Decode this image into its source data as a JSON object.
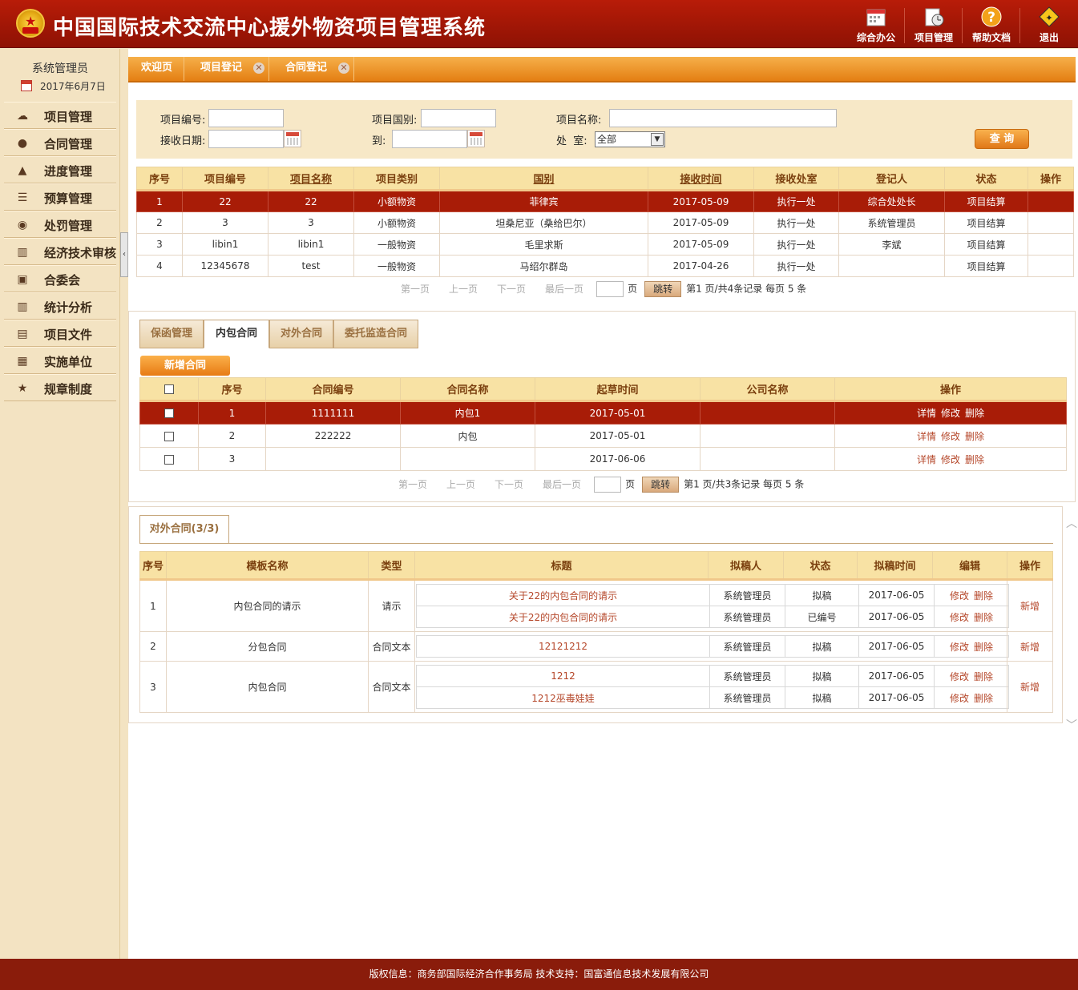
{
  "app": {
    "title": "中国国际技术交流中心援外物资项目管理系统"
  },
  "topnav": [
    {
      "label": "综合办公",
      "icon": "calendar-icon"
    },
    {
      "label": "项目管理",
      "icon": "clipboard-clock-icon"
    },
    {
      "label": "帮助文档",
      "icon": "help-icon"
    },
    {
      "label": "退出",
      "icon": "exit-sign-icon"
    }
  ],
  "user": {
    "name": "系统管理员",
    "date": "2017年6月7日"
  },
  "sidebar": {
    "items": [
      {
        "label": "项目管理",
        "icon": "cloud-icon"
      },
      {
        "label": "合同管理",
        "icon": "tag-icon"
      },
      {
        "label": "进度管理",
        "icon": "chart-mountain-icon"
      },
      {
        "label": "预算管理",
        "icon": "list-icon"
      },
      {
        "label": "处罚管理",
        "icon": "pill-icon"
      },
      {
        "label": "经济技术审核",
        "icon": "bar-chart-icon"
      },
      {
        "label": "合委会",
        "icon": "picture-icon"
      },
      {
        "label": "统计分析",
        "icon": "stats-icon"
      },
      {
        "label": "项目文件",
        "icon": "image-icon"
      },
      {
        "label": "实施单位",
        "icon": "document-icon"
      },
      {
        "label": "规章制度",
        "icon": "star-icon"
      }
    ]
  },
  "tabs": [
    {
      "label": "欢迎页",
      "closable": false
    },
    {
      "label": "项目登记",
      "closable": true
    },
    {
      "label": "合同登记",
      "closable": true
    }
  ],
  "search": {
    "project_no_label": "项目编号:",
    "project_type_label": "项目国别:",
    "project_name_label": "项目名称:",
    "receive_date_label": "接收日期:",
    "to_label": "到:",
    "dept_label": "处  室:",
    "dept_value": "全部",
    "query_button": "查 询"
  },
  "project_table": {
    "headers": [
      "序号",
      "项目编号",
      "项目名称",
      "项目类别",
      "国别",
      "接收时间",
      "接收处室",
      "登记人",
      "状态",
      "操作"
    ],
    "rows": [
      [
        "1",
        "22",
        "22",
        "小额物资",
        "菲律宾",
        "2017-05-09",
        "执行一处",
        "综合处处长",
        "项目结算",
        ""
      ],
      [
        "2",
        "3",
        "3",
        "小额物资",
        "坦桑尼亚（桑给巴尔）",
        "2017-05-09",
        "执行一处",
        "系统管理员",
        "项目结算",
        ""
      ],
      [
        "3",
        "libin1",
        "libin1",
        "一般物资",
        "毛里求斯",
        "2017-05-09",
        "执行一处",
        "李斌",
        "项目结算",
        ""
      ],
      [
        "4",
        "12345678",
        "test",
        "一般物资",
        "马绍尔群岛",
        "2017-04-26",
        "执行一处",
        "",
        "项目结算",
        ""
      ]
    ],
    "pager": {
      "first": "第一页",
      "prev": "上一页",
      "next": "下一页",
      "last": "最后一页",
      "page_unit": "页",
      "jump": "跳转",
      "info": "第1 页/共4条记录 每页 5 条"
    }
  },
  "contract_section": {
    "tabs": [
      "保函管理",
      "内包合同",
      "对外合同",
      "委托监造合同"
    ],
    "add_button": "新增合同",
    "headers": [
      "序号",
      "合同编号",
      "合同名称",
      "起草时间",
      "公司名称",
      "操作"
    ],
    "rows": [
      [
        "1",
        "1111111",
        "内包1",
        "2017-05-01",
        ""
      ],
      [
        "2",
        "222222",
        "内包",
        "2017-05-01",
        ""
      ],
      [
        "3",
        "",
        "",
        "2017-06-06",
        ""
      ]
    ],
    "actions": {
      "detail": "详情",
      "edit": "修改",
      "delete": "删除"
    },
    "pager": {
      "first": "第一页",
      "prev": "上一页",
      "next": "下一页",
      "last": "最后一页",
      "page_unit": "页",
      "jump": "跳转",
      "info": "第1 页/共3条记录 每页 5 条"
    }
  },
  "external_section": {
    "tab": "对外合同(3/3)",
    "headers": [
      "序号",
      "模板名称",
      "类型",
      "标题",
      "拟稿人",
      "状态",
      "拟稿时间",
      "编辑",
      "操作"
    ],
    "groups": [
      {
        "no": "1",
        "template": "内包合同的请示",
        "type": "请示",
        "add": "新增",
        "docs": [
          {
            "title": "关于22的内包合同的请示",
            "author": "系统管理员",
            "status": "拟稿",
            "time": "2017-06-05"
          },
          {
            "title": "关于22的内包合同的请示",
            "author": "系统管理员",
            "status": "已编号",
            "time": "2017-06-05"
          }
        ]
      },
      {
        "no": "2",
        "template": "分包合同",
        "type": "合同文本",
        "add": "新增",
        "docs": [
          {
            "title": "12121212",
            "author": "系统管理员",
            "status": "拟稿",
            "time": "2017-06-05"
          }
        ]
      },
      {
        "no": "3",
        "template": "内包合同",
        "type": "合同文本",
        "add": "新增",
        "docs": [
          {
            "title": "1212",
            "author": "系统管理员",
            "status": "拟稿",
            "time": "2017-06-05"
          },
          {
            "title": "1212巫毒娃娃",
            "author": "系统管理员",
            "status": "拟稿",
            "time": "2017-06-05"
          }
        ]
      }
    ],
    "edit_label": "修改",
    "delete_label": "删除"
  },
  "footer": {
    "text": "版权信息：商务部国际经济合作事务局  技术支持：国富通信息技术发展有限公司"
  }
}
